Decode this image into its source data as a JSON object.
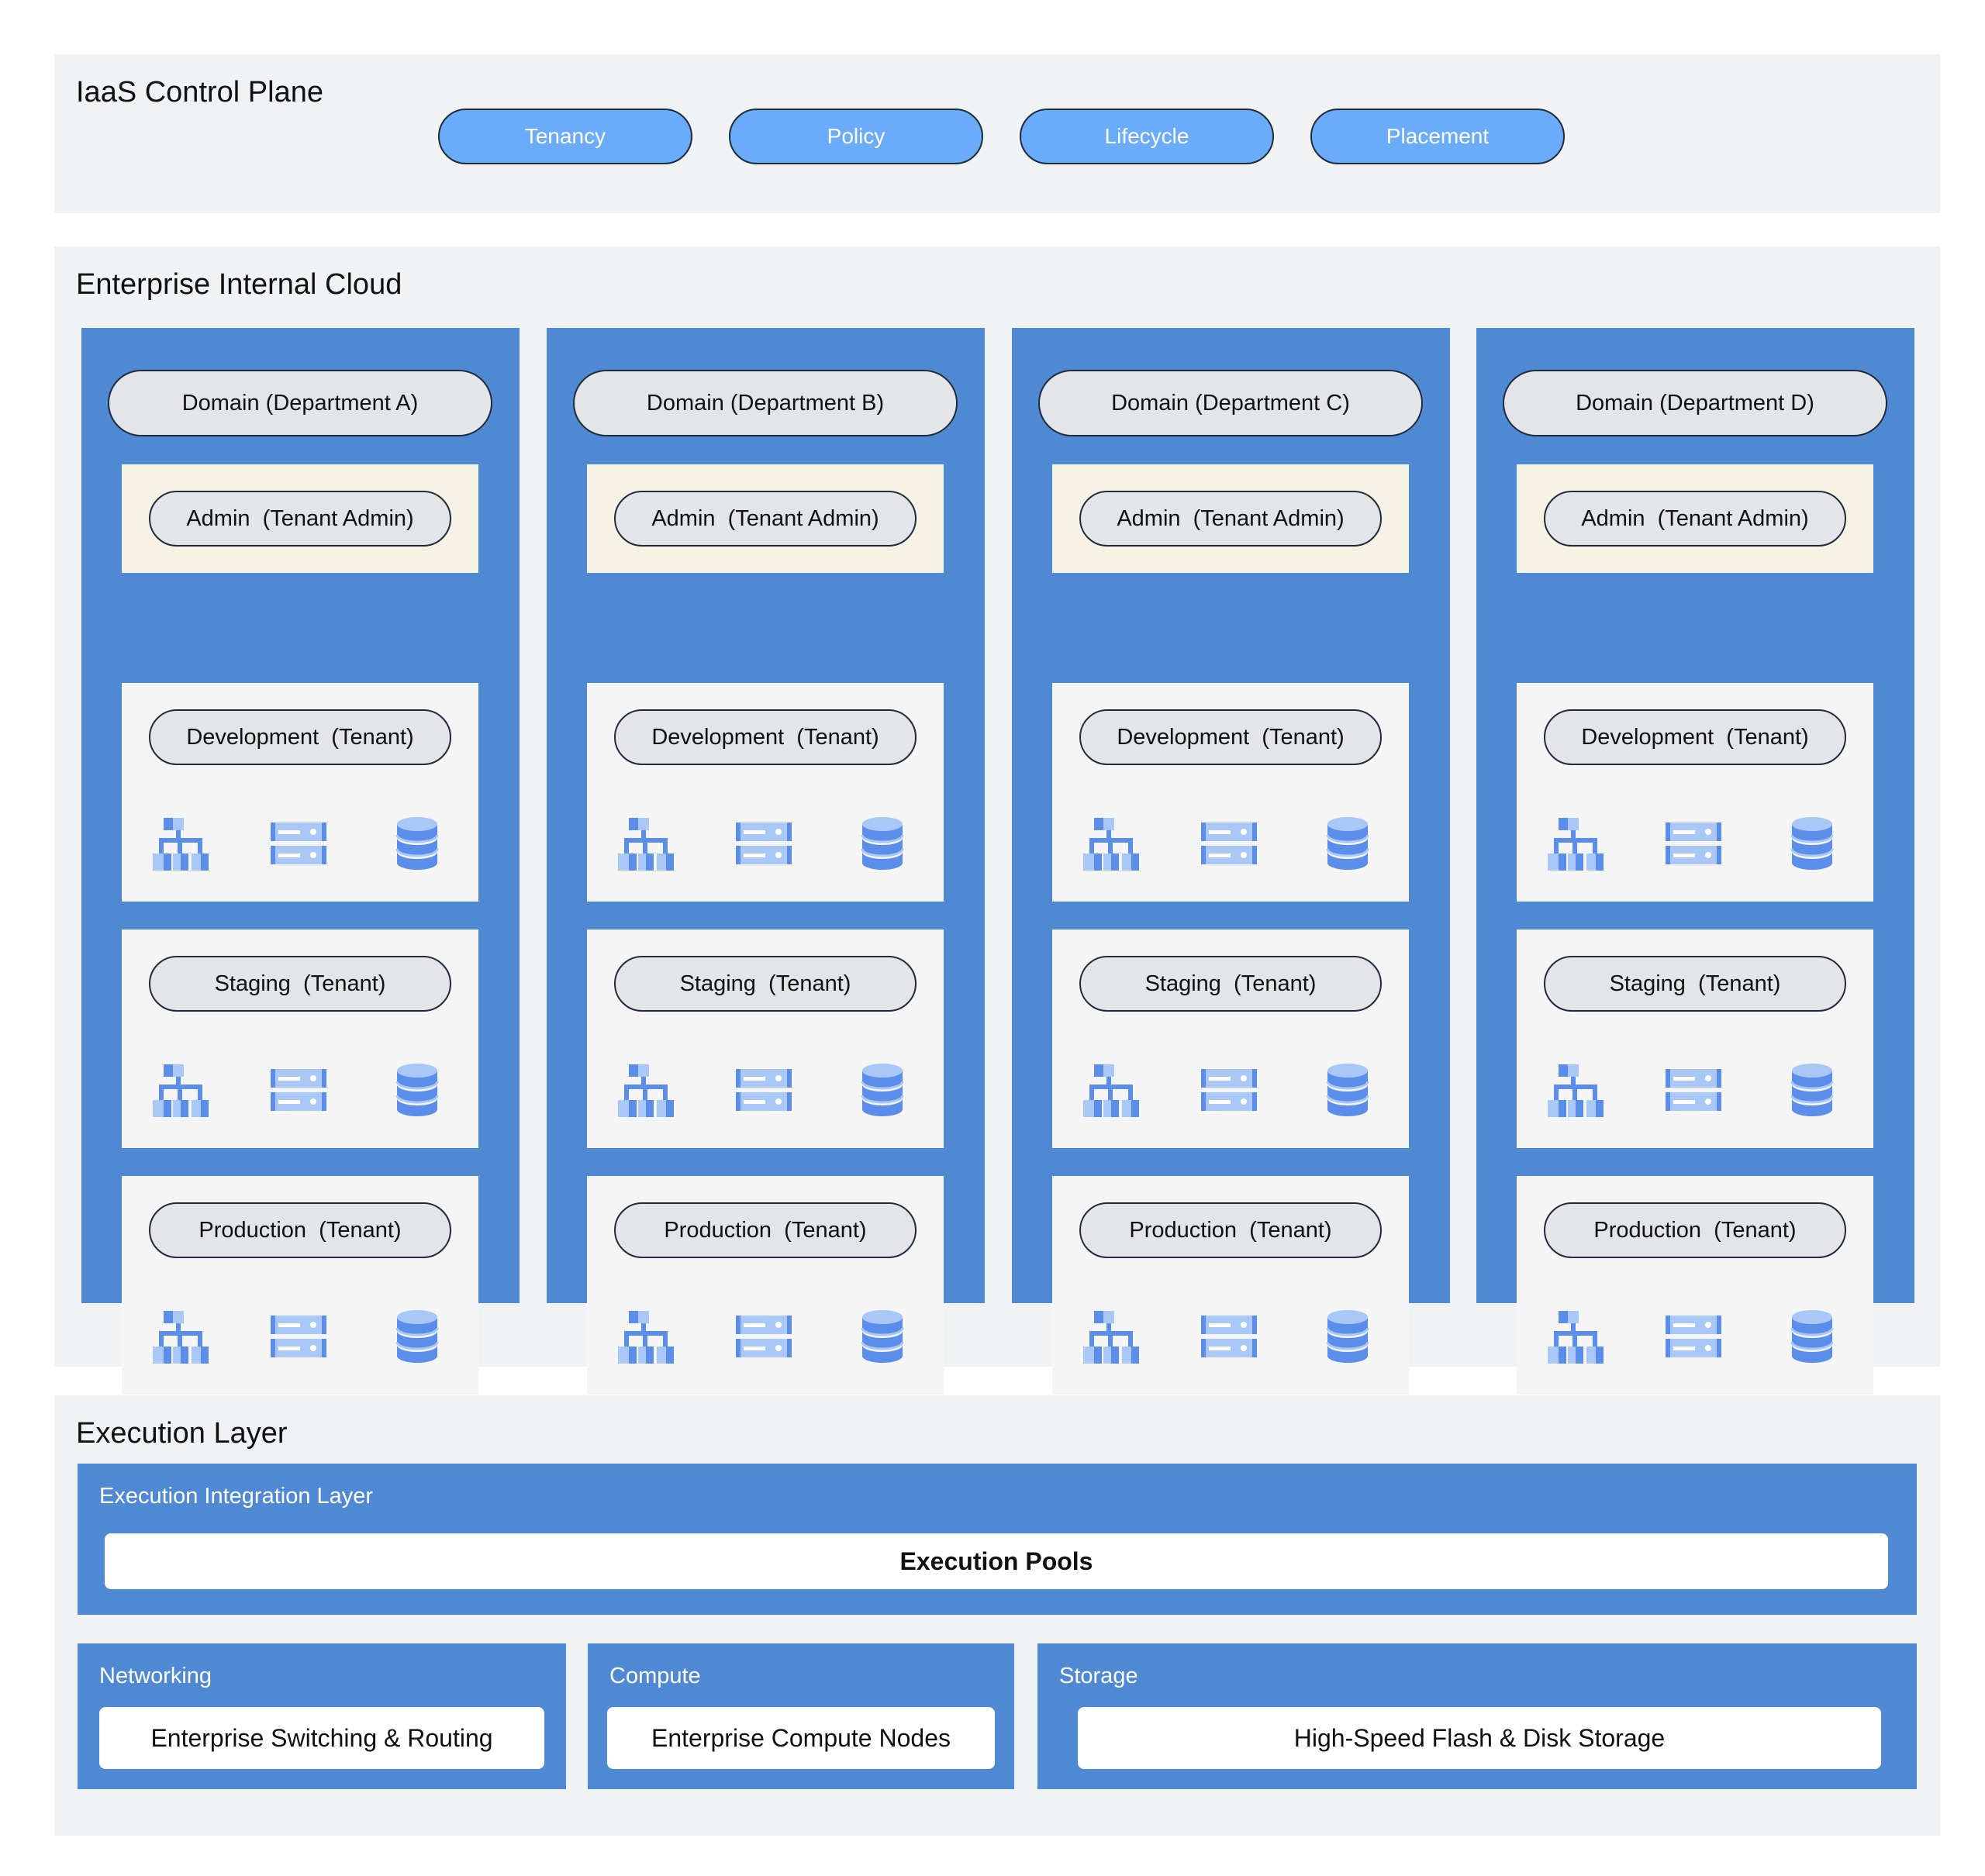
{
  "control_plane": {
    "title": "IaaS Control Plane",
    "pills": [
      "Tenancy",
      "Policy",
      "Lifecycle",
      "Placement"
    ]
  },
  "cloud": {
    "title": "Enterprise Internal Cloud",
    "departments": [
      {
        "domain": "Domain (Department A)"
      },
      {
        "domain": "Domain (Department B)"
      },
      {
        "domain": "Domain (Department C)"
      },
      {
        "domain": "Domain (Department D)"
      }
    ],
    "tenants": {
      "admin": "Admin  (Tenant Admin)",
      "development": "Development  (Tenant)",
      "staging": "Staging  (Tenant)",
      "production": "Production  (Tenant)"
    },
    "resource_icons": [
      "network-topology-icon",
      "server-icon",
      "database-icon"
    ]
  },
  "execution": {
    "title": "Execution Layer",
    "integration_label": "Execution Integration Layer",
    "pools": "Execution Pools",
    "networking_label": "Networking",
    "networking_item": "Enterprise Switching & Routing",
    "compute_label": "Compute",
    "compute_item": "Enterprise Compute Nodes",
    "storage_label": "Storage",
    "storage_item": "High-Speed Flash & Disk Storage"
  },
  "colors": {
    "panel_blue": "#4f89d4",
    "pill_blue": "#6aacf9",
    "icon_blue": "#5a8eea",
    "icon_light": "#a9c8f7",
    "section_bg": "#f1f2f4",
    "admin_bg": "#f6f3e4"
  }
}
